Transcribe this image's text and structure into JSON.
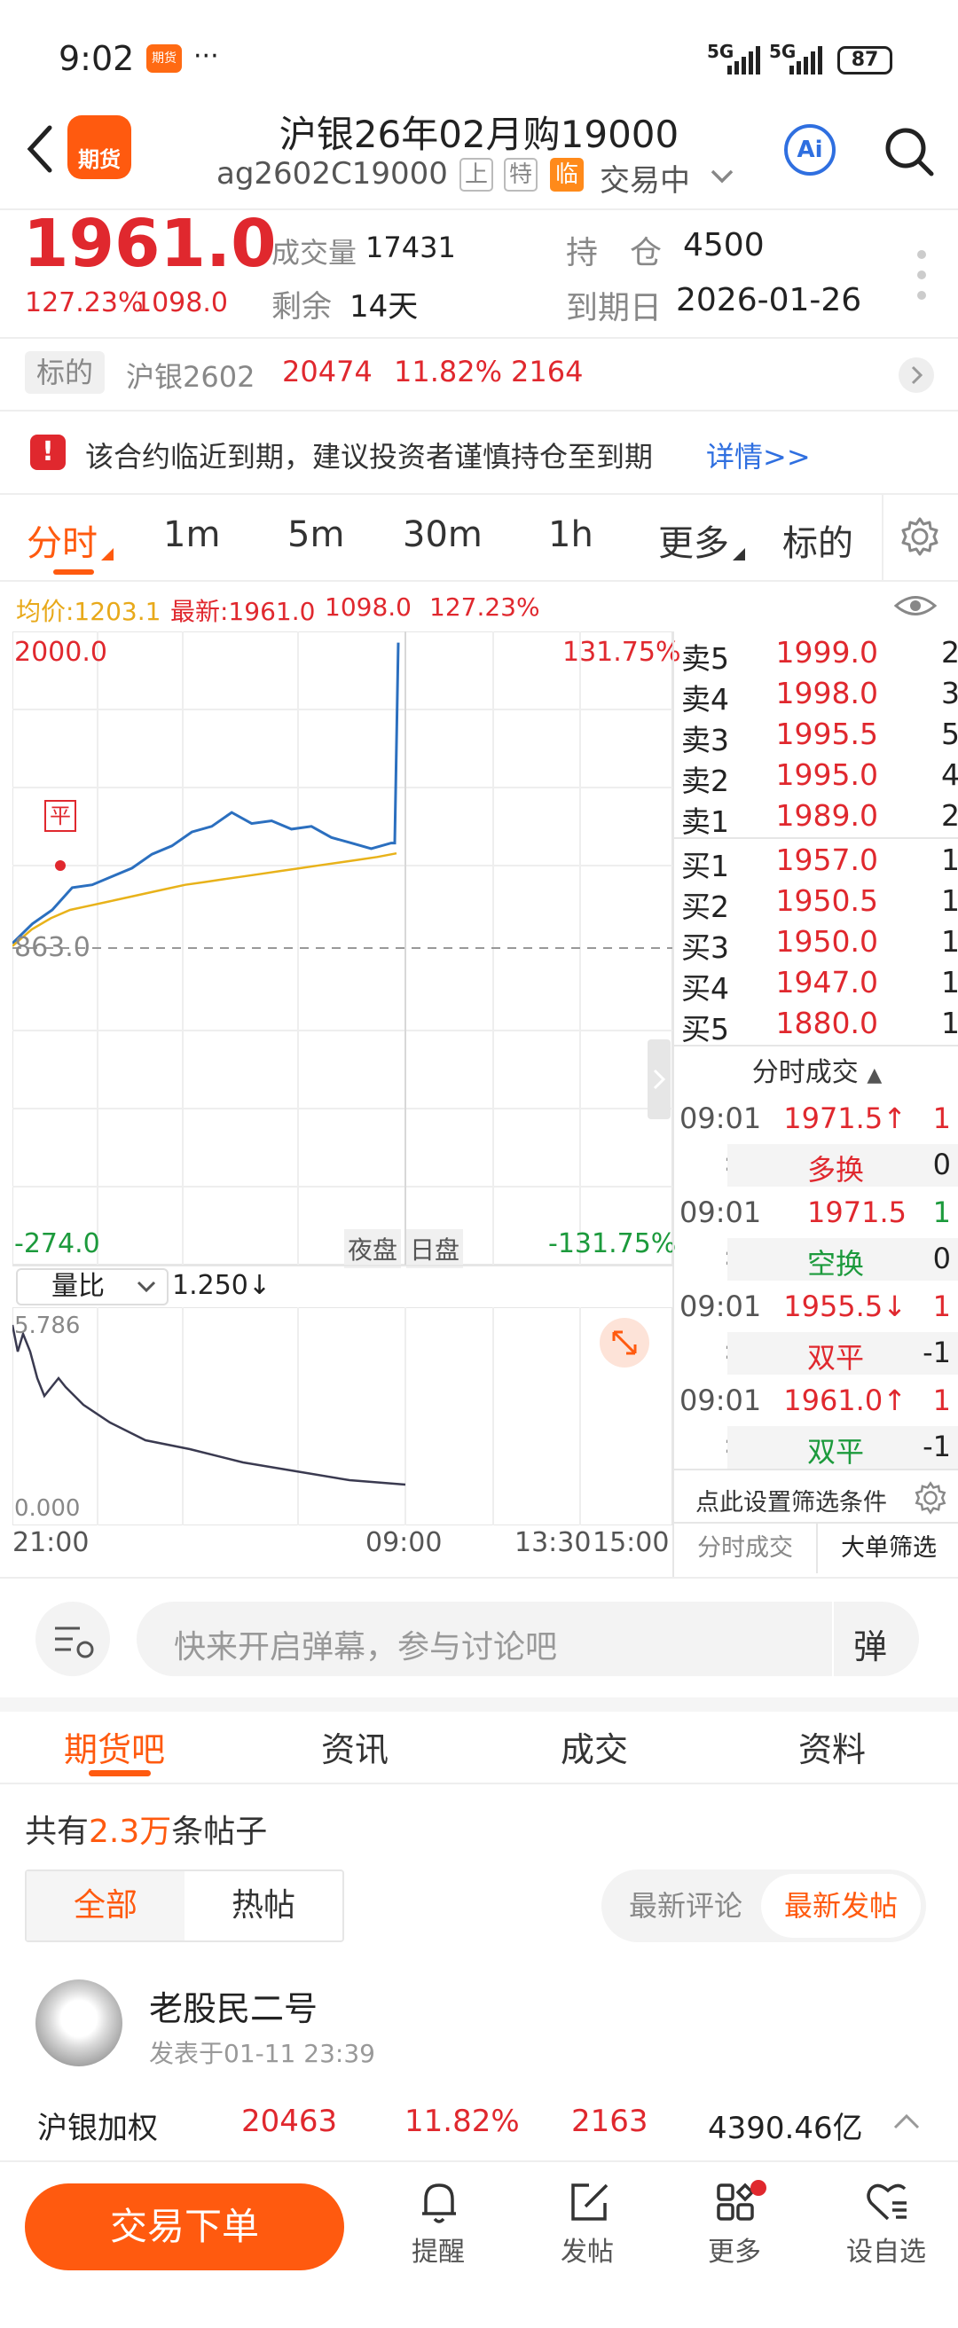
{
  "status_bar": {
    "time": "9:02",
    "app_badge": "期货",
    "more": "···",
    "signal1": "5G",
    "signal2": "5G",
    "battery": "87"
  },
  "header": {
    "logo_text": "期货",
    "title": "沪银26年02月购19000",
    "code": "ag2602C19000",
    "tag1": "上",
    "tag2": "特",
    "tag3": "临",
    "trading_status": "交易中",
    "ai_label": "Ai"
  },
  "quote": {
    "price": "1961.0",
    "change_pct": "127.23%",
    "change": "1098.0",
    "volume_label": "成交量",
    "volume": "17431",
    "remaining_label": "剩余",
    "remaining": "14天",
    "oi_label": "持　仓",
    "oi": "4500",
    "expiry_label": "到期日",
    "expiry": "2026-01-26"
  },
  "underlying": {
    "label": "标的",
    "name": "沪银2602",
    "price": "20474",
    "pct": "11.82%",
    "change": "2164"
  },
  "notice": {
    "text": "该合约临近到期，建议投资者谨慎持仓至到期",
    "link": "详情>>"
  },
  "chart_tabs": {
    "items": [
      "分时",
      "1m",
      "5m",
      "30m",
      "1h",
      "更多",
      "标的"
    ],
    "active": "分时"
  },
  "chart_info": {
    "avg": "均价:1203.1",
    "latest": "最新:1961.0",
    "change": "1098.0",
    "pct": "127.23%"
  },
  "chart_labels": {
    "y_top": "2000.0",
    "y_mid": "863.0",
    "y_bottom": "-274.0",
    "pct_top": "131.75%",
    "pct_bottom": "-131.75%",
    "session_night": "夜盘",
    "session_day": "日盘",
    "marker": "平",
    "t0": "21:00",
    "t1": "09:00",
    "t2": "13:30",
    "t3": "15:00"
  },
  "volume_ratio": {
    "select": "量比",
    "value": "1.250↓",
    "top": "5.786",
    "bottom": "0.000"
  },
  "order_book": {
    "asks": [
      {
        "label": "卖5",
        "price": "1999.0",
        "vol": "2"
      },
      {
        "label": "卖4",
        "price": "1998.0",
        "vol": "3"
      },
      {
        "label": "卖3",
        "price": "1995.5",
        "vol": "5"
      },
      {
        "label": "卖2",
        "price": "1995.0",
        "vol": "4"
      },
      {
        "label": "卖1",
        "price": "1989.0",
        "vol": "2"
      }
    ],
    "bids": [
      {
        "label": "买1",
        "price": "1957.0",
        "vol": "1"
      },
      {
        "label": "买2",
        "price": "1950.5",
        "vol": "1"
      },
      {
        "label": "买3",
        "price": "1950.0",
        "vol": "1"
      },
      {
        "label": "买4",
        "price": "1947.0",
        "vol": "1"
      },
      {
        "label": "买5",
        "price": "1880.0",
        "vol": "1"
      }
    ]
  },
  "trades": {
    "title": "分时成交",
    "items": [
      {
        "time": "09:01",
        "sec": ":24",
        "price": "1971.5↑",
        "qty": "1",
        "type": "多换",
        "oi": "0"
      },
      {
        "time": "09:01",
        "sec": ":24",
        "price": "1971.5",
        "qty": "1",
        "type": "空换",
        "oi": "0"
      },
      {
        "time": "09:01",
        "sec": ":25",
        "price": "1955.5↓",
        "qty": "1",
        "type": "双平",
        "oi": "-1"
      },
      {
        "time": "09:01",
        "sec": ":26",
        "price": "1961.0↑",
        "qty": "1",
        "type": "双平",
        "oi": "-1"
      }
    ],
    "filter_hint": "点此设置筛选条件",
    "tab1": "分时成交",
    "tab2": "大单筛选"
  },
  "comment": {
    "placeholder": "快来开启弹幕，参与讨论吧",
    "danmu": "弹"
  },
  "section_tabs": [
    "期货吧",
    "资讯",
    "成交",
    "资料"
  ],
  "posts": {
    "count_prefix": "共有",
    "count": "2.3万",
    "count_suffix": "条帖子",
    "filter1": "全部",
    "filter2": "热帖",
    "sort1": "最新评论",
    "sort2": "最新发帖"
  },
  "post": {
    "author": "老股民二号",
    "time": "发表于01-11 23:39"
  },
  "index_ticker": {
    "name": "沪银加权",
    "price": "20463",
    "pct": "11.82%",
    "change": "2163",
    "amount": "4390.46亿"
  },
  "bottom_nav": {
    "order": "交易下单",
    "items": [
      "提醒",
      "发帖",
      "更多",
      "设自选"
    ]
  },
  "colors": {
    "accent": "#ff5a0f",
    "up": "#e0282e",
    "down": "#1c9a3c",
    "line": "#2b6fbf",
    "avg": "#e8b21a"
  },
  "chart_data": {
    "type": "line",
    "x": [
      "21:00",
      "09:00",
      "13:30",
      "15:00"
    ],
    "ylim": [
      -274.0,
      2000.0
    ],
    "series": [
      {
        "values": [
          880,
          950,
          1000,
          1080,
          1090,
          1120,
          1150,
          1200,
          1230,
          1280,
          1300,
          1350,
          1310,
          1320,
          1290,
          1300,
          1260,
          1240,
          1220,
          1240,
          1960
        ]
      },
      {
        "values": [
          870,
          930,
          970,
          1000,
          1015,
          1030,
          1045,
          1060,
          1075,
          1090,
          1100,
          1110,
          1120,
          1130,
          1140,
          1150,
          1160,
          1170,
          1180,
          1190,
          1203.1
        ]
      }
    ]
  }
}
